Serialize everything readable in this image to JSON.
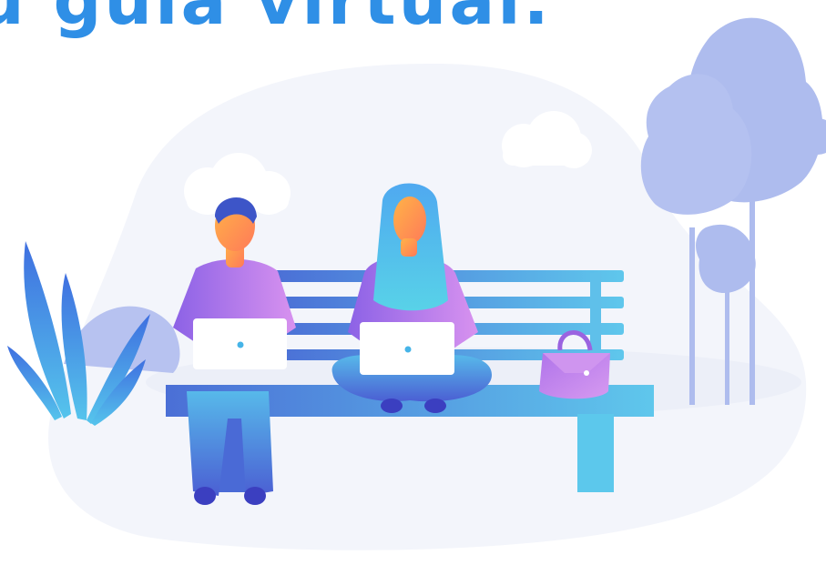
{
  "headline": "u guía virtual.",
  "colors": {
    "headline": "#2f8fe6",
    "background_blob": "#f3f5fb",
    "tree": "#aebcee",
    "bench": "#5aa6e6",
    "laptop": "#ffffff",
    "shirt": "#b77ee9",
    "bag": "#c38ae8"
  },
  "scene": {
    "people_on_bench": 2,
    "objects": [
      "bench",
      "man-with-laptop",
      "woman-with-laptop",
      "handbag",
      "trees",
      "plant",
      "clouds"
    ]
  }
}
